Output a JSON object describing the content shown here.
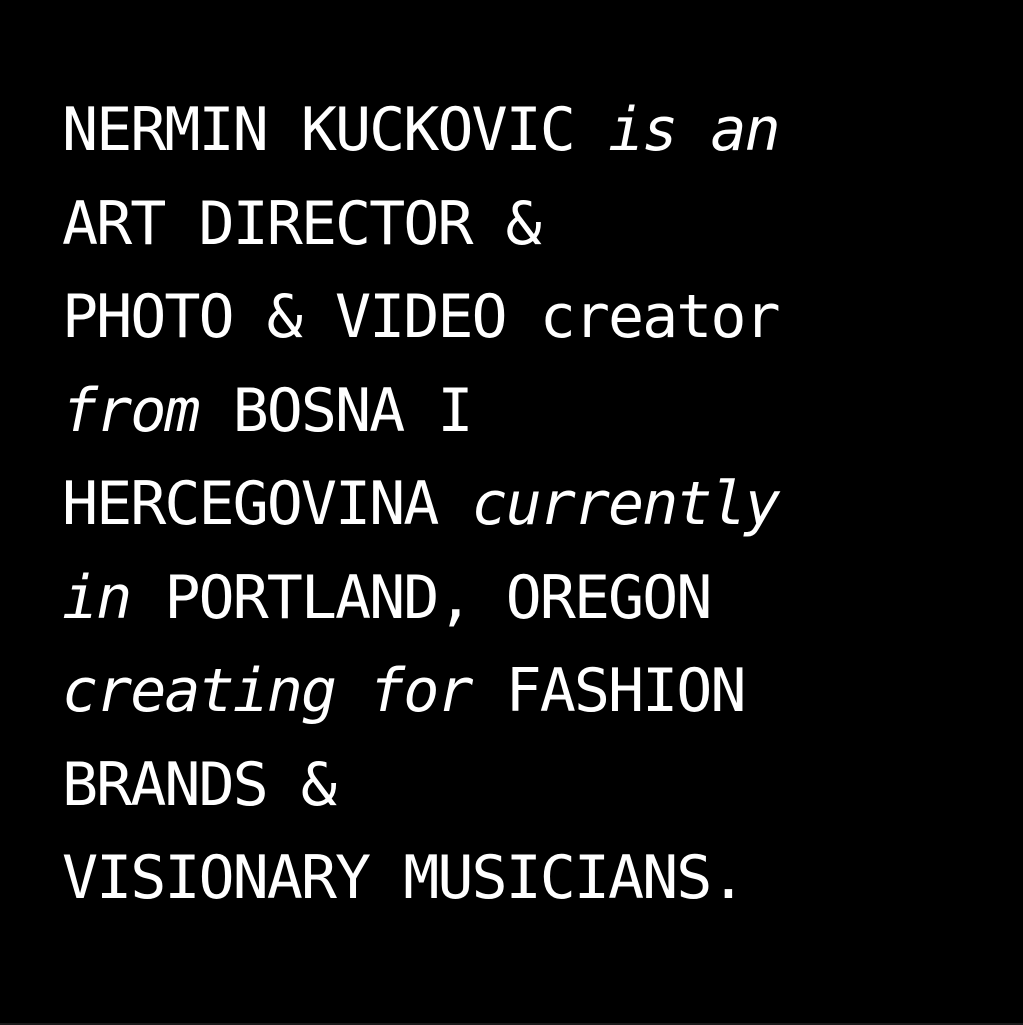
{
  "colors": {
    "background": "#000000",
    "text": "#ffffff"
  },
  "bio": {
    "line1": {
      "name": "NERMIN KUCKOVIC ",
      "connector": "is an"
    },
    "line2": {
      "text": "ART DIRECTOR &"
    },
    "line3": {
      "role": "PHOTO & VIDEO",
      "suffix": " creator"
    },
    "line4": {
      "connector": "from",
      "place": " BOSNA I"
    },
    "line5": {
      "place": "HERCEGOVINA ",
      "connector": "currently"
    },
    "line6": {
      "connector": "in",
      "place": " PORTLAND, OREGON"
    },
    "line7": {
      "connector": "creating for",
      "subject": " FASHION"
    },
    "line8": {
      "text": "BRANDS &"
    },
    "line9": {
      "text": "VISIONARY MUSICIANS."
    }
  }
}
